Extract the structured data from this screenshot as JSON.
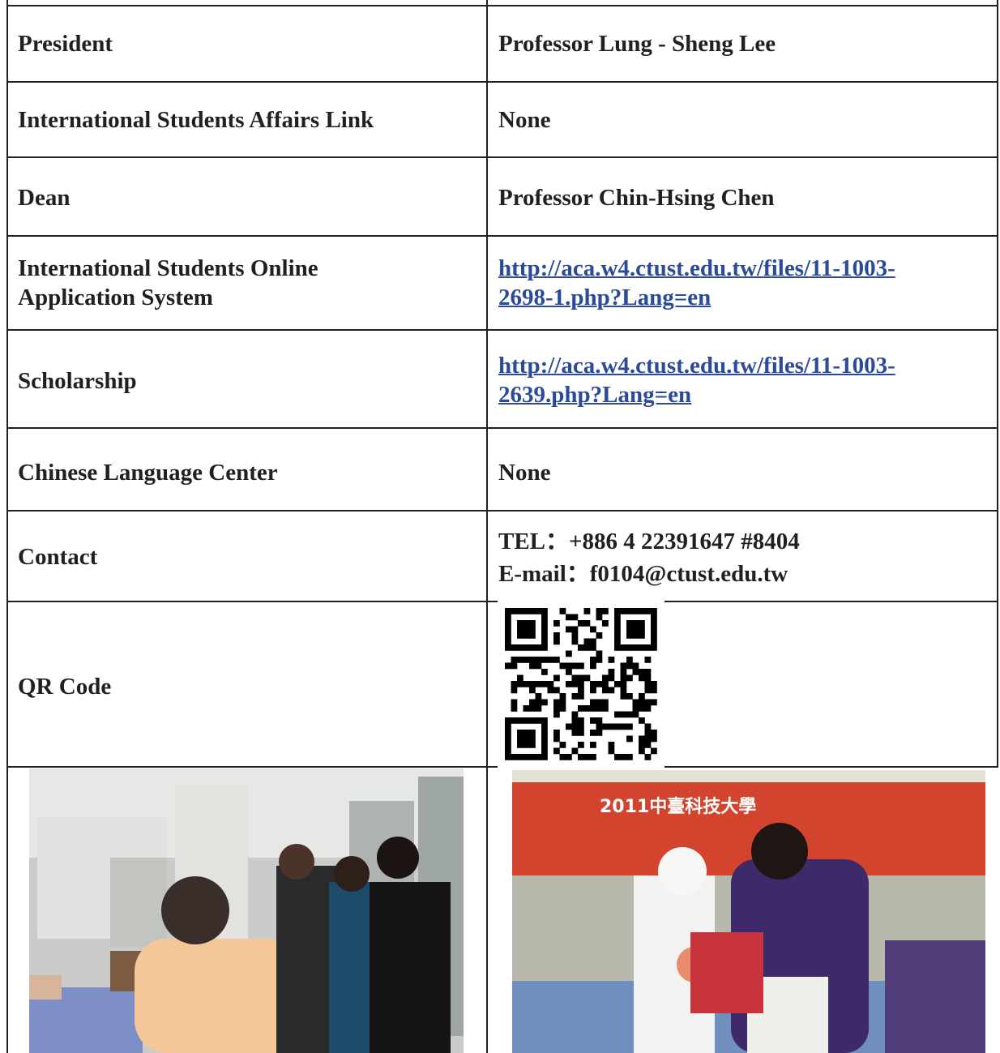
{
  "rows": [
    {
      "label": "President",
      "value": "Professor Lung - Sheng Lee"
    },
    {
      "label": "International Students Affairs Link",
      "value": "None"
    },
    {
      "label": "Dean",
      "value": "Professor Chin-Hsing Chen"
    },
    {
      "label_line1": "International Students Online",
      "label_line2": "Application System",
      "link_line1": "http://aca.w4.ctust.edu.tw/files/11-1003-",
      "link_line2": "2698-1.php?Lang=en"
    },
    {
      "label": "Scholarship",
      "link_line1": "http://aca.w4.ctust.edu.tw/files/11-1003-",
      "link_line2": "2639.php?Lang=en"
    },
    {
      "label": "Chinese Language Center",
      "value": "None"
    },
    {
      "label": "Contact",
      "tel": "TEL：+886 4 22391647 #8404",
      "email": "E-mail：f0104@ctust.edu.tw"
    },
    {
      "label": "QR Code"
    }
  ],
  "photos": {
    "right_banner_text": "2011中臺科技大學"
  },
  "colors": {
    "link": "#2b4a9a",
    "border": "#231f20",
    "text": "#231f20"
  }
}
